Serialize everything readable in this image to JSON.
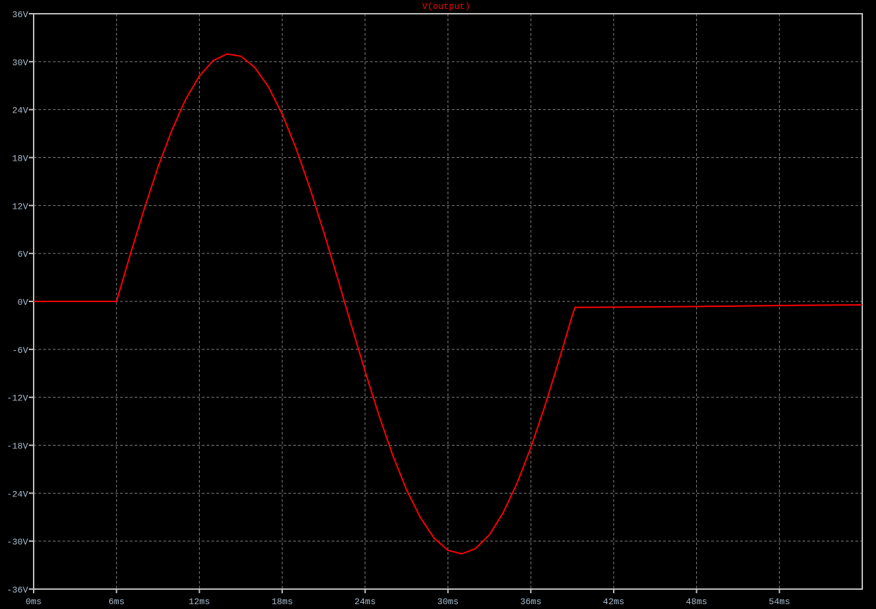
{
  "chart_data": {
    "type": "line",
    "title": "V(output)",
    "xlabel": "",
    "ylabel": "",
    "xlim": [
      0,
      60
    ],
    "ylim": [
      -36,
      36
    ],
    "grid": true,
    "x_ticks": [
      0,
      6,
      12,
      18,
      24,
      30,
      36,
      42,
      48,
      54
    ],
    "x_tick_labels": [
      "0ms",
      "6ms",
      "12ms",
      "18ms",
      "24ms",
      "30ms",
      "36ms",
      "42ms",
      "48ms",
      "54ms"
    ],
    "y_ticks": [
      36,
      30,
      24,
      18,
      12,
      6,
      0,
      -6,
      -12,
      -18,
      -24,
      -30,
      -36
    ],
    "y_tick_labels": [
      "36V",
      "30V",
      "24V",
      "18V",
      "12V",
      "6V",
      "0V",
      "-6V",
      "-12V",
      "-18V",
      "-24V",
      "-30V",
      "-36V"
    ],
    "colors": {
      "background": "#000000",
      "trace": "#ff0000",
      "axis": "#c0c0c0",
      "grid": "#808080",
      "labels": "#a8bccc"
    },
    "series": [
      {
        "name": "V(output)",
        "x_unit": "ms",
        "y_unit": "V",
        "x": [
          0,
          6,
          7,
          8,
          9,
          10,
          11,
          12,
          13,
          14,
          15,
          16,
          17,
          18,
          19,
          20,
          21,
          22,
          22.5,
          23,
          24,
          25,
          26,
          27,
          28,
          29,
          30,
          31,
          32,
          33,
          34,
          35,
          36,
          37,
          38,
          39,
          39.2,
          44,
          50,
          55,
          60
        ],
        "y": [
          0,
          0,
          5.87,
          11.52,
          16.76,
          21.39,
          25.26,
          28.2,
          30.13,
          30.97,
          30.68,
          29.3,
          26.85,
          23.43,
          19.16,
          14.2,
          8.73,
          2.95,
          0,
          -2.95,
          -8.75,
          -14.24,
          -19.24,
          -23.56,
          -27.05,
          -29.63,
          -31.15,
          -31.59,
          -30.93,
          -29.2,
          -26.44,
          -22.77,
          -18.3,
          -13.2,
          -7.62,
          -1.77,
          -0.75,
          -0.7,
          -0.6,
          -0.5,
          -0.43
        ]
      }
    ]
  }
}
